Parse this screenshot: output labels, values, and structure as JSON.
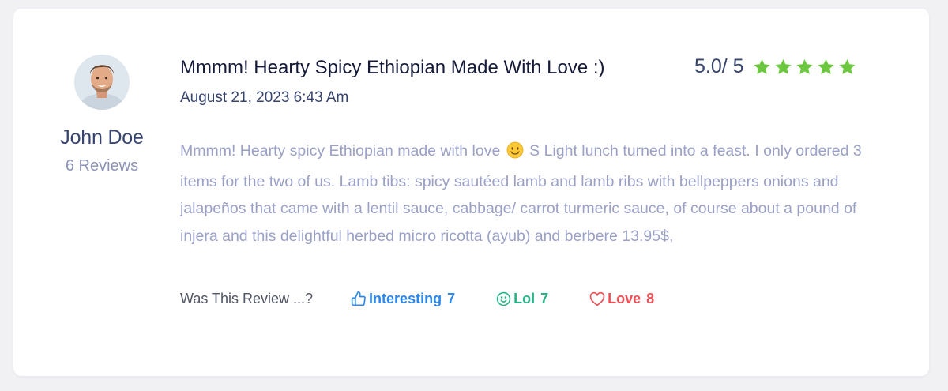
{
  "author": {
    "name": "John Doe",
    "reviews_label": "6 Reviews",
    "avatar_icon": "user-avatar"
  },
  "review": {
    "title": "Mmmm! Hearty Spicy Ethiopian Made With Love :)",
    "date": "August 21, 2023 6:43 Am",
    "rating_text": "5.0/ 5",
    "rating_value": 5,
    "rating_max": 5,
    "star_color": "#6cc93f",
    "body_before_emoji": "Mmmm! Hearty spicy Ethiopian made with love",
    "body_emoji_icon": "smiling-face-emoji",
    "body_after_emoji": "S Light lunch turned into a feast. I only ordered 3 items for the two of us. Lamb tibs: spicy sautéed lamb and lamb ribs with bellpeppers onions and jalapeños that came with a lentil sauce, cabbage/ carrot turmeric sauce, of course about a pound of injera and this delightful herbed micro ricotta (ayub) and berbere 13.95$,"
  },
  "feedback": {
    "prompt": "Was This Review ...?",
    "reactions": [
      {
        "label": "Interesting",
        "count": "7",
        "icon": "thumbs-up-icon",
        "color": "#2d88ec"
      },
      {
        "label": "Lol",
        "count": "7",
        "icon": "smile-icon",
        "color": "#27b387"
      },
      {
        "label": "Love",
        "count": "8",
        "icon": "heart-icon",
        "color": "#ef4f55"
      }
    ]
  }
}
